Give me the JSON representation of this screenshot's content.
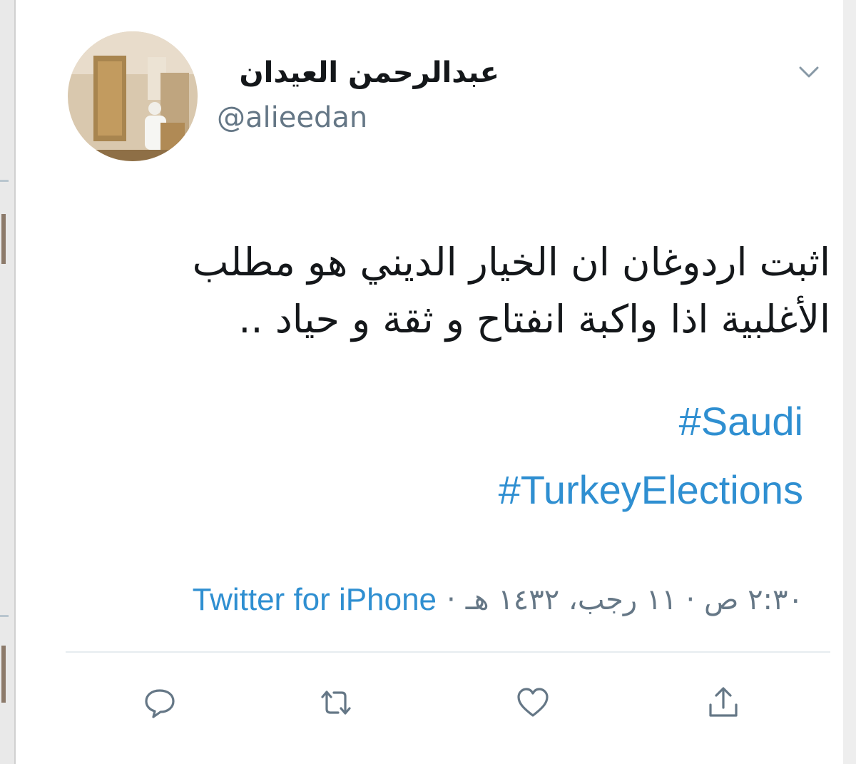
{
  "tweet": {
    "author": {
      "display_name": "عبدالرحمن العيدان",
      "handle": "@alieedan"
    },
    "text": "اثبت اردوغان ان الخيار الديني هو مطلب\nالأغلبية اذا واكبة انفتاح و ثقة و حياد ..",
    "hashtags": [
      "#Saudi",
      "#TurkeyElections"
    ],
    "timestamp": "٢:٣٠ ص · ١١ رجب، ١٤٣٢ هـ",
    "separator": "·",
    "source": "Twitter for iPhone",
    "actions": [
      {
        "name": "reply",
        "icon": "reply-icon"
      },
      {
        "name": "retweet",
        "icon": "retweet-icon"
      },
      {
        "name": "like",
        "icon": "heart-icon"
      },
      {
        "name": "share",
        "icon": "share-icon"
      }
    ]
  },
  "colors": {
    "link": "#2f8fd1",
    "text": "#14171a",
    "muted": "#657786",
    "divider": "#e6ecf0"
  }
}
